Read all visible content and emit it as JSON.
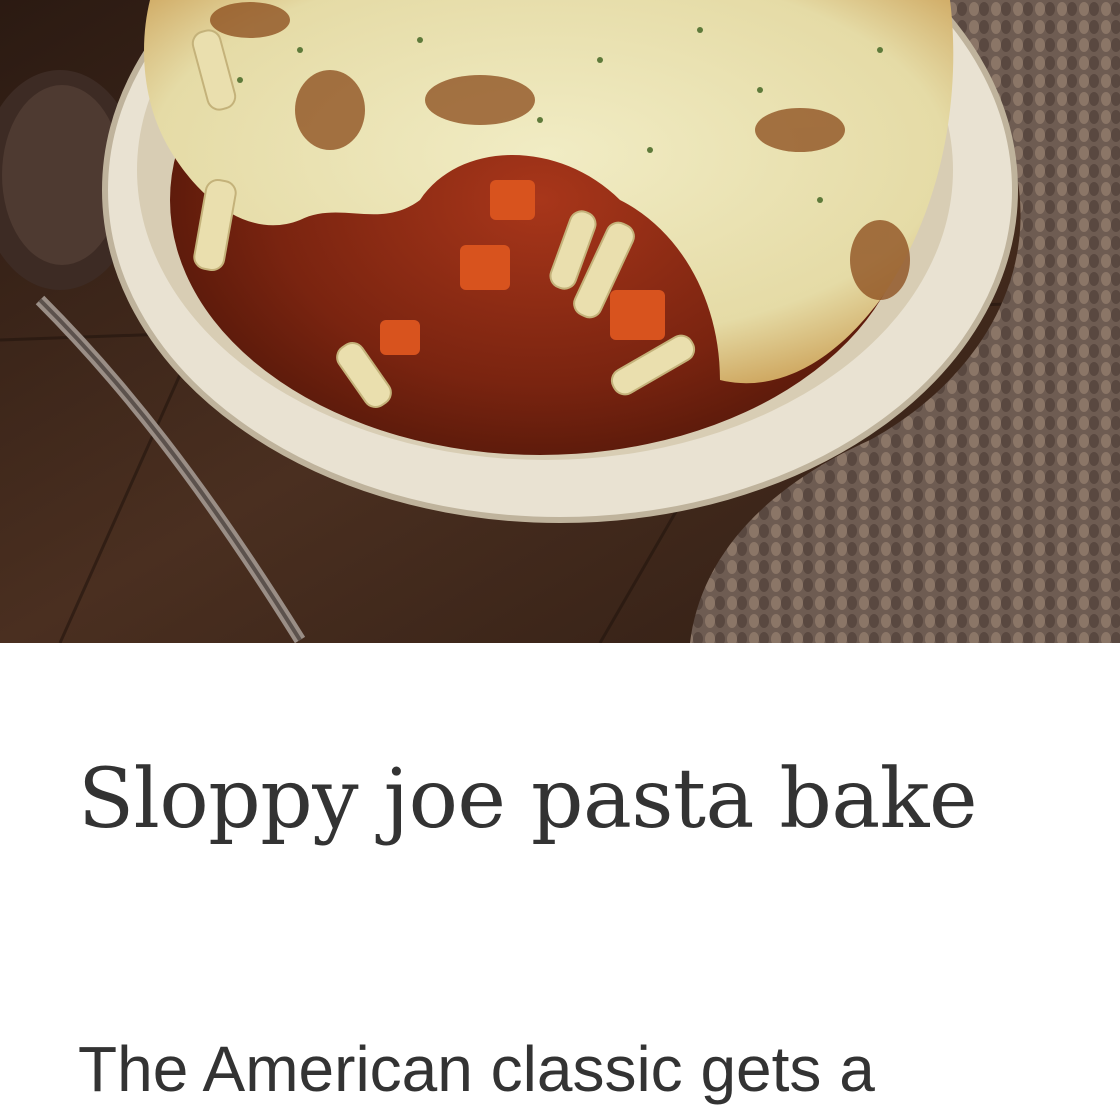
{
  "recipe": {
    "hero_image": "sloppy-joe-pasta-bake-photo",
    "title": "Sloppy joe pasta bake",
    "description": "The American classic gets a"
  },
  "colors": {
    "text": "#333333",
    "background": "#ffffff"
  }
}
